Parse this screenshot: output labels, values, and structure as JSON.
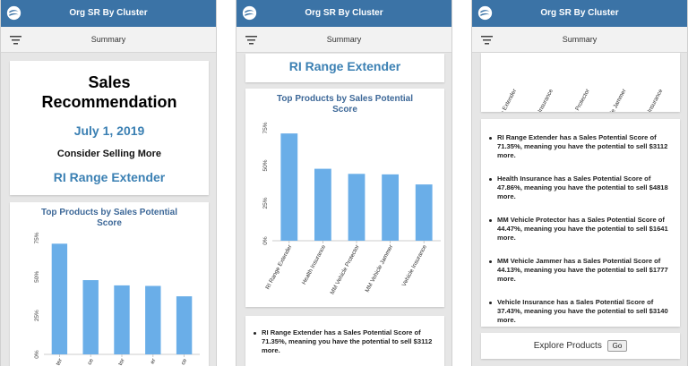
{
  "app": {
    "title": "Org SR By Cluster",
    "logo_icon": "swirl-logo-icon",
    "header_color": "#3b73a6"
  },
  "toolbar": {
    "label": "Summary",
    "menu_icon": "filter-menu-icon"
  },
  "summary": {
    "line1": "Sales",
    "line2": "Recommendation",
    "date": "July 1, 2019",
    "consider": "Consider Selling More",
    "product": "RI Range Extender"
  },
  "chart_data": {
    "type": "bar",
    "title_line1": "Top Products by Sales Potential",
    "title_line2": "Score",
    "categories": [
      "RI Range Extender",
      "Health Insurance",
      "MM Vehicle Protector",
      "MM Vehicle Jammer",
      "Vehicle Insurance"
    ],
    "values": [
      71.35,
      47.86,
      44.47,
      44.13,
      37.43
    ],
    "ylim": [
      0,
      75
    ],
    "yticks": [
      "0%",
      "25%",
      "50%",
      "75%"
    ],
    "bar_color": "#6aaee8",
    "grid": false,
    "x_tick_fragments": [
      "ter",
      "ce",
      "tor",
      "er",
      "ce"
    ]
  },
  "recommendations": [
    {
      "text": "RI Range Extender has a Sales Potential Score of 71.35%, meaning you have the potential to sell $3112 more."
    },
    {
      "text": "Health Insurance has a Sales Potential Score of 47.86%, meaning you have the potential to sell $4818 more."
    },
    {
      "text": "MM Vehicle Protector has a Sales Potential Score of 44.47%, meaning you have the potential to sell $1641 more."
    },
    {
      "text": "MM Vehicle Jammer has a Sales Potential Score of 44.13%, meaning you have the potential to sell $1777 more."
    },
    {
      "text": "Vehicle Insurance has a Sales Potential Score of 37.43%, meaning you have the potential to sell $3140 more."
    }
  ],
  "explore": {
    "label": "Explore Products",
    "button": "Go"
  }
}
